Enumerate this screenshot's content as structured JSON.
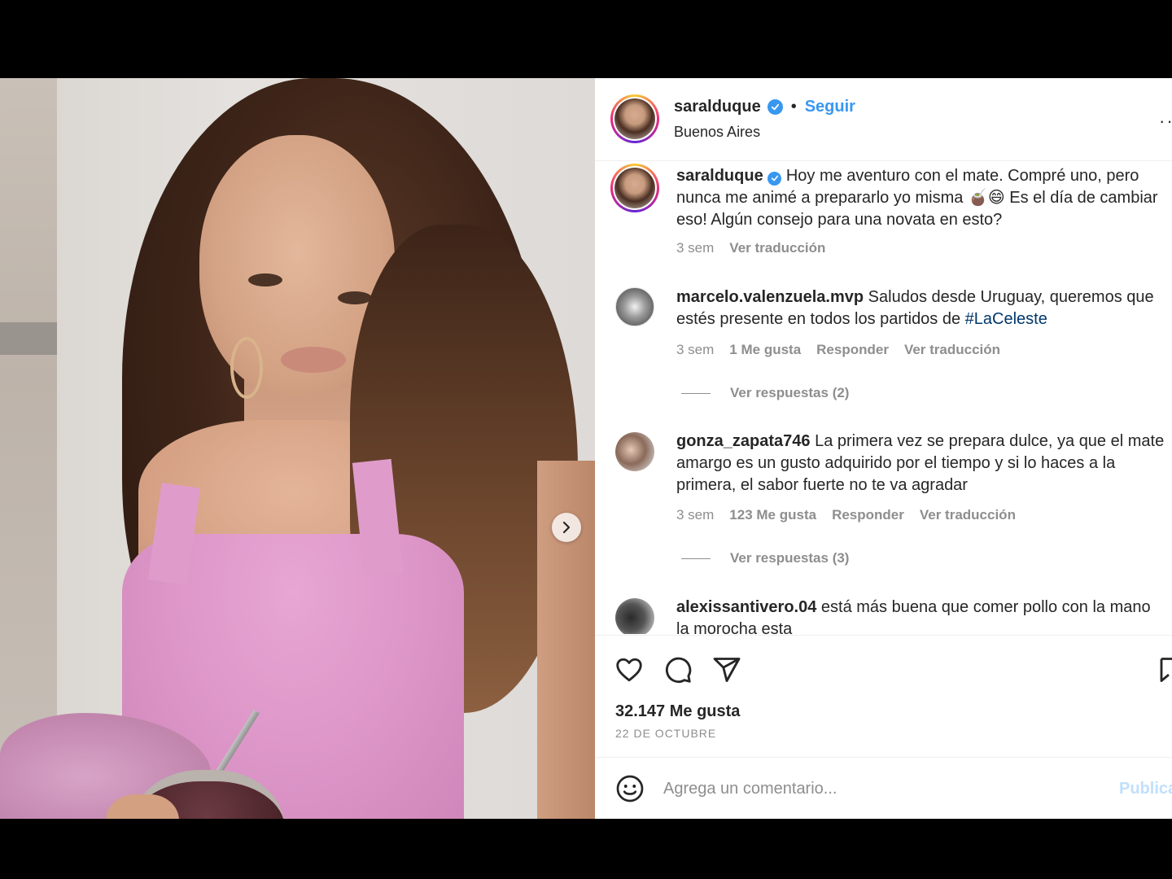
{
  "post": {
    "username": "saralduque",
    "follow_label": "Seguir",
    "location": "Buenos Aires",
    "more_label": "··",
    "separator": "•"
  },
  "media": {
    "total_slides": 2,
    "current_slide": 1
  },
  "comments": [
    {
      "username": "saralduque",
      "verified": true,
      "text": "Hoy me aventuro con el mate. Compré uno, pero nunca me animé a prepararlo yo misma 🧉😄 Es el día de cambiar eso! Algún consejo para una novata en esto?",
      "time": "3 sem",
      "translate": "Ver traducción"
    },
    {
      "username": "marcelo.valenzuela.mvp",
      "text": "Saludos desde Uruguay, queremos que estés presente en todos los partidos de ",
      "hashtag": "#LaCeleste",
      "time": "3 sem",
      "likes": "1 Me gusta",
      "reply": "Responder",
      "translate": "Ver traducción",
      "view_replies": "Ver respuestas (2)"
    },
    {
      "username": "gonza_zapata746",
      "text": "La primera vez se prepara dulce, ya que el mate amargo es un gusto adquirido por el tiempo y si lo haces a la primera, el sabor fuerte no te va agradar",
      "time": "3 sem",
      "likes": "123 Me gusta",
      "reply": "Responder",
      "translate": "Ver traducción",
      "view_replies": "Ver respuestas (3)"
    },
    {
      "username": "alexissantivero.04",
      "text": "está más buena que comer pollo con la mano la morocha esta"
    }
  ],
  "actions": {
    "likes_count": "32.147 Me gusta",
    "date": "22 DE OCTUBRE"
  },
  "add_comment": {
    "placeholder": "Agrega un comentario...",
    "publish_label": "Publicar"
  },
  "colors": {
    "accent": "#3897f0",
    "text": "#262626",
    "secondary": "#8e8e8e",
    "hashtag": "#00376b"
  }
}
